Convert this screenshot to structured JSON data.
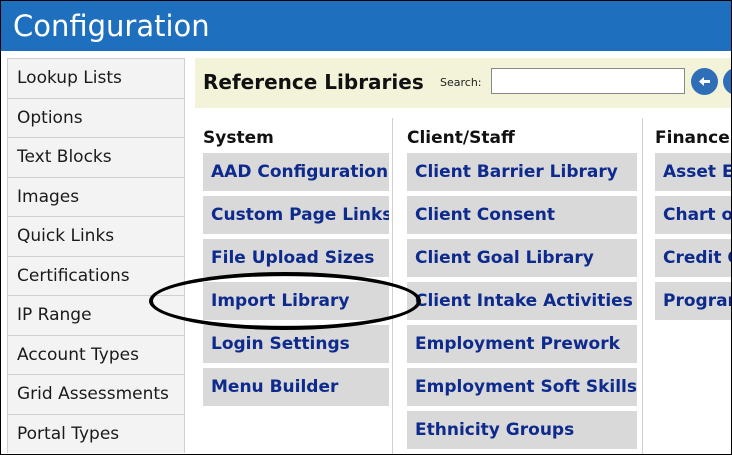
{
  "window": {
    "title": "Configuration"
  },
  "sidebar": {
    "items": [
      {
        "label": "Lookup Lists"
      },
      {
        "label": "Options"
      },
      {
        "label": "Text Blocks"
      },
      {
        "label": "Images"
      },
      {
        "label": "Quick Links"
      },
      {
        "label": "Certifications"
      },
      {
        "label": "IP Range"
      },
      {
        "label": "Account Types"
      },
      {
        "label": "Grid Assessments"
      },
      {
        "label": "Portal Types"
      }
    ]
  },
  "main": {
    "title": "Reference Libraries",
    "search": {
      "label": "Search:",
      "value": "",
      "placeholder": ""
    },
    "columns": [
      {
        "header": "System",
        "items": [
          "AAD Configuration",
          "Custom Page Links",
          "File Upload Sizes",
          "Import Library",
          "Login Settings",
          "Menu Builder"
        ]
      },
      {
        "header": "Client/Staff",
        "items": [
          "Client Barrier Library",
          "Client Consent",
          "Client Goal Library",
          "Client Intake Activities",
          "Employment Prework",
          "Employment Soft Skills",
          "Ethnicity Groups"
        ]
      },
      {
        "header": "Finance",
        "items": [
          "Asset Ex",
          "Chart of",
          "Credit C",
          "Program"
        ]
      }
    ]
  },
  "icons": {
    "back": "back-arrow-icon",
    "next": "circle-icon"
  },
  "colors": {
    "titlebar": "#1f6fbf",
    "library_bar": "#f3f3d9",
    "item_bg": "#d9d9d9",
    "link": "#0d2a8c"
  }
}
